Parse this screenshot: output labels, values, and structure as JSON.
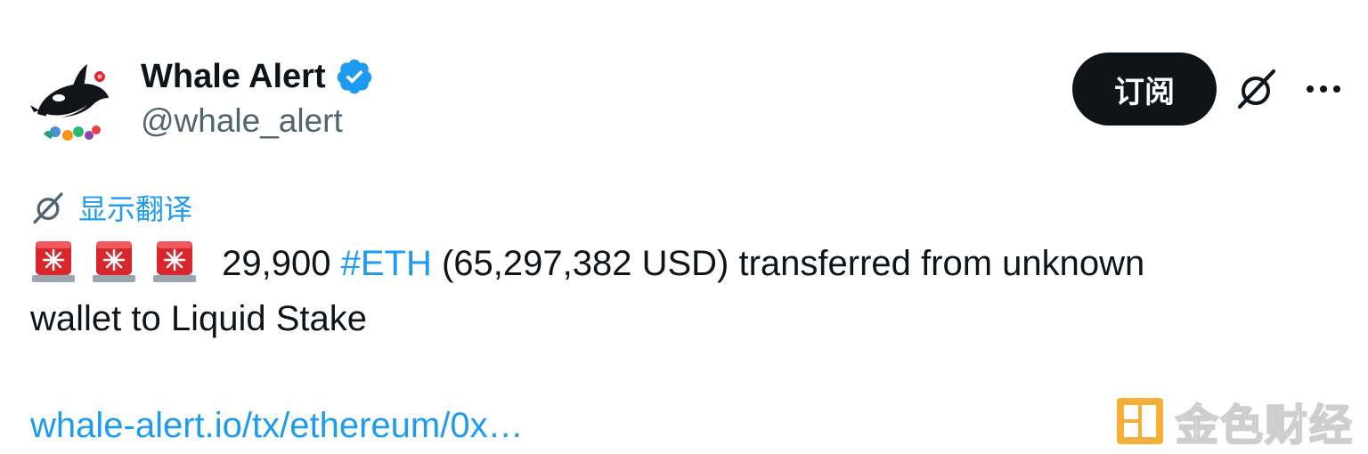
{
  "header": {
    "display_name": "Whale Alert",
    "handle": "@whale_alert",
    "verified": true,
    "verified_color": "#1d9bf0",
    "subscribe_label": "订阅",
    "grok_icon": "grok-icon",
    "more_icon": "more-icon"
  },
  "translate": {
    "label": "显示翻译",
    "icon": "grok-icon"
  },
  "tweet": {
    "siren_icons": [
      "rotating-light-icon",
      "rotating-light-icon",
      "rotating-light-icon"
    ],
    "amount": "29,900",
    "hashtag": "#ETH",
    "text_rest_line1": "(65,297,382 USD) transferred from unknown",
    "text_line2": "wallet to Liquid Stake",
    "link_text": "whale-alert.io/tx/ethereum/0x…"
  },
  "watermark": {
    "text": "金色财经",
    "logo_color": "#f5a623"
  },
  "colors": {
    "accent": "#1d9bf0",
    "text": "#0f1419",
    "secondary_text": "#536471",
    "button_bg": "#0f1419"
  }
}
